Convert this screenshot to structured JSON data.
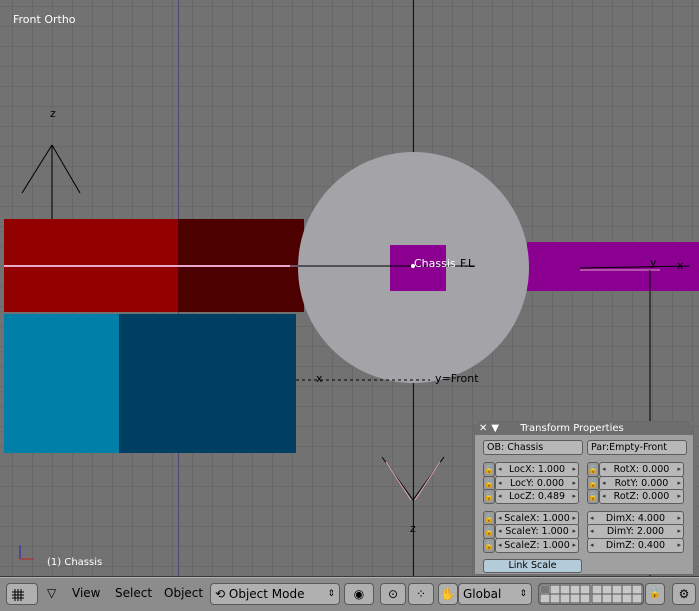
{
  "viewport": {
    "title": "Front Ortho",
    "status": "(1) Chassis",
    "labels": {
      "z_top": "z",
      "z_bottom": "z",
      "x_left": "x",
      "y_right": "y",
      "x_right": "x",
      "chassis": "Chassis",
      "fl": "F.L",
      "empty_front": "y=Front"
    }
  },
  "panel": {
    "title": "Transform Properties",
    "ob": "OB: Chassis",
    "par": "Par:Empty-Front",
    "loc": [
      {
        "label": "LocX: 1.000"
      },
      {
        "label": "LocY: 0.000"
      },
      {
        "label": "LocZ: 0.489"
      }
    ],
    "rot": [
      {
        "label": "RotX: 0.000"
      },
      {
        "label": "RotY: 0.000"
      },
      {
        "label": "RotZ: 0.000"
      }
    ],
    "scale": [
      {
        "label": "ScaleX: 1.000"
      },
      {
        "label": "ScaleY: 1.000"
      },
      {
        "label": "ScaleZ: 1.000"
      }
    ],
    "dim": [
      {
        "label": "DimX: 4.000"
      },
      {
        "label": "DimY: 2.000"
      },
      {
        "label": "DimZ: 0.400"
      }
    ],
    "link_scale": "Link Scale"
  },
  "toolbar": {
    "view": "View",
    "select": "Select",
    "object": "Object",
    "mode": "Object Mode",
    "orientation": "Global"
  }
}
